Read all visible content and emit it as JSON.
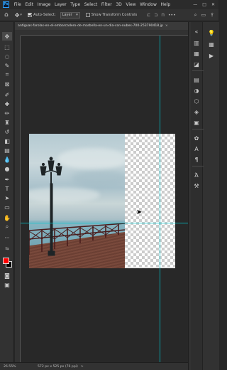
{
  "app": {
    "logo_text": "Ps"
  },
  "menu": [
    "File",
    "Edit",
    "Image",
    "Layer",
    "Type",
    "Select",
    "Filter",
    "3D",
    "View",
    "Window",
    "Help"
  ],
  "window_controls": {
    "minimize": "—",
    "maximize": "□",
    "close": "✕"
  },
  "options_bar": {
    "auto_select_label": "Auto-Select:",
    "auto_select_checked": true,
    "auto_select_target": "Layer",
    "transform_controls_label": "Show Transform Controls",
    "transform_controls_checked": false,
    "more_label": "•••"
  },
  "document": {
    "tab_title": "antiguas-farolas-en-el-embarcadero-de-marbella-en-un-dia-con-nubes-700-253790418.jp",
    "tab_close": "×",
    "zoom": "26.55%",
    "doc_info": "572 px x 525 px (76 ppi)",
    "status_caret": ">"
  },
  "colors": {
    "foreground": "#ff0000",
    "background": "#000000",
    "guide": "#00c8d0"
  }
}
